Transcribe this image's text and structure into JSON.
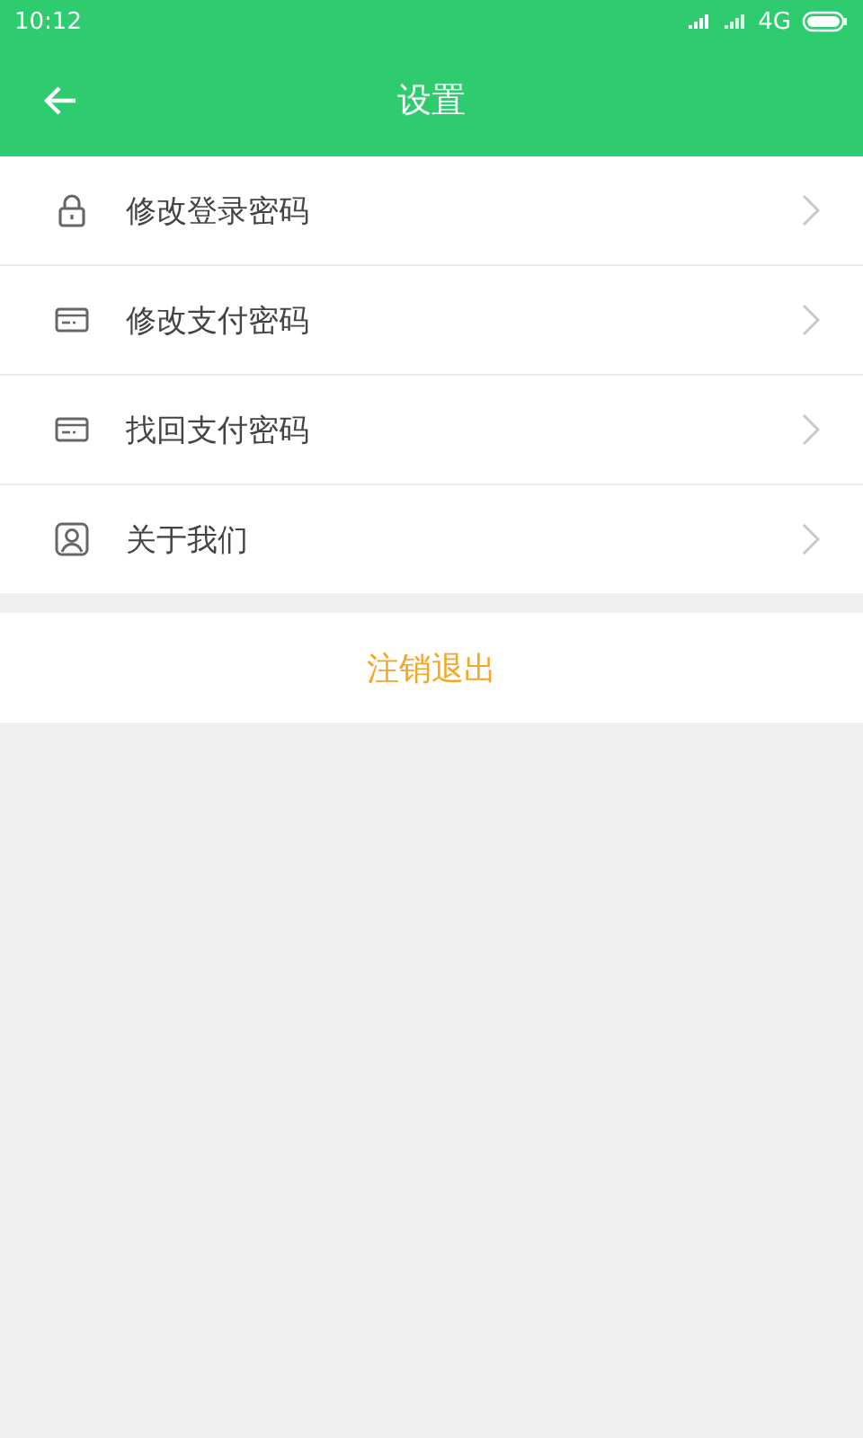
{
  "status_bar": {
    "time": "10:12",
    "network": "4G"
  },
  "header": {
    "title": "设置"
  },
  "menu": [
    {
      "kind": "lock",
      "label": "修改登录密码"
    },
    {
      "kind": "card",
      "label": "修改支付密码"
    },
    {
      "kind": "card",
      "label": "找回支付密码"
    },
    {
      "kind": "person",
      "label": "关于我们"
    }
  ],
  "logout": {
    "label": "注销退出"
  }
}
